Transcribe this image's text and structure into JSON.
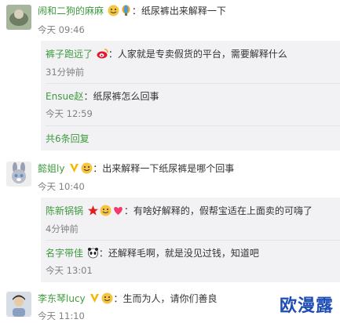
{
  "comments": [
    {
      "user": "闹和二狗的麻麻",
      "separator": "：",
      "text": "纸尿裤出来解释一下",
      "time": "今天 09:46",
      "replies": [
        {
          "user": "裤子跑远了",
          "separator": "：",
          "text": "人家就是专卖假货的平台，需要解释什么",
          "time": "31分钟前"
        },
        {
          "user": "Ensue赵",
          "separator": "：",
          "text": "纸尿裤怎么回事",
          "time": "今天 12:59"
        }
      ],
      "more_replies": "共6条回复"
    },
    {
      "user": "懿姐ly",
      "separator": "：",
      "text": "出来解释一下纸尿裤是哪个回事",
      "time": "今天 10:40",
      "replies": [
        {
          "user": "陈新锅锅",
          "separator": "：",
          "text": "有啥好解释的，假帮宝适在上面卖的可嗨了",
          "time": "4分钟前"
        },
        {
          "user": "名字带佳",
          "separator": "：",
          "text": "还解释毛啊，就是没见过钱，知道吧",
          "time": "今天 13:01"
        }
      ]
    },
    {
      "user": "李东琴lucy",
      "separator": "：",
      "text": "生而为人，请你们善良",
      "time": "今天 11:10"
    }
  ],
  "watermark": "欧漫露",
  "colors": {
    "username_orange": "#eb7350",
    "username_green": "#3e9a3e",
    "reply_bg": "#f2f2f5",
    "watermark": "#1e4db4"
  }
}
